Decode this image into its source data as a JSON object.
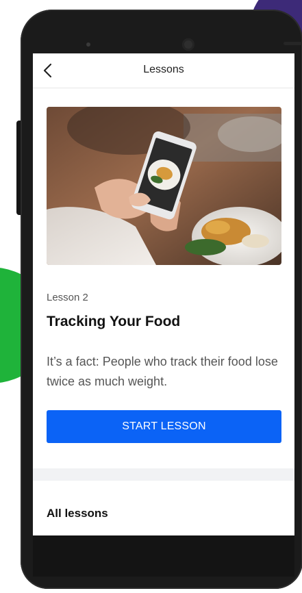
{
  "header": {
    "title": "Lessons",
    "back_icon": "chevron-left-icon"
  },
  "lesson": {
    "number_label": "Lesson 2",
    "title": "Tracking Your Food",
    "description": "It’s a fact: People who track their food lose twice as much weight.",
    "start_button_label": "START LESSON"
  },
  "section": {
    "all_lessons_title": "All lessons"
  },
  "colors": {
    "accent_button": "#0b63f6",
    "text_primary": "#111111",
    "text_secondary": "#555555",
    "section_band": "#f1f2f4",
    "bg_green": "#1fb33a",
    "bg_purple": "#3d2a78",
    "bg_blue": "#1aa7e0"
  }
}
